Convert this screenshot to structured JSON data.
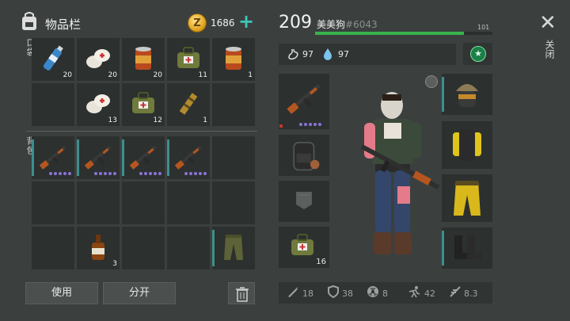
{
  "header": {
    "title": "物品栏",
    "coin_symbol": "Z",
    "coin_count": "1686",
    "add_symbol": "+"
  },
  "sections": {
    "pockets_label": "口袋",
    "backpack_label": "背包"
  },
  "pocket_slots": [
    {
      "item": "water-bottle",
      "qty": "20"
    },
    {
      "item": "bandage",
      "qty": "20"
    },
    {
      "item": "canned-food",
      "qty": "20"
    },
    {
      "item": "first-aid-bag",
      "qty": "11"
    },
    {
      "item": "canned-food",
      "qty": "1"
    },
    {
      "item": "empty",
      "qty": ""
    },
    {
      "item": "bandage",
      "qty": "13"
    },
    {
      "item": "first-aid-bag",
      "qty": "12"
    },
    {
      "item": "ammo",
      "qty": "1"
    },
    {
      "item": "empty",
      "qty": ""
    }
  ],
  "backpack_slots": [
    {
      "item": "rifle"
    },
    {
      "item": "rifle"
    },
    {
      "item": "rifle"
    },
    {
      "item": "rifle"
    },
    {
      "item": "empty"
    },
    {
      "item": "empty"
    },
    {
      "item": "empty"
    },
    {
      "item": "empty"
    },
    {
      "item": "empty"
    },
    {
      "item": "empty"
    },
    {
      "item": "empty"
    },
    {
      "item": "whiskey",
      "qty": "3"
    },
    {
      "item": "empty"
    },
    {
      "item": "empty"
    },
    {
      "item": "cargo-pants"
    }
  ],
  "actions": {
    "use_label": "使用",
    "split_label": "分开"
  },
  "player": {
    "level": "209",
    "name": "美美狗",
    "id": "#6043",
    "xp_label": "101",
    "xp_fraction": 0.84,
    "food": "97",
    "water": "97"
  },
  "equipment": {
    "weapon_label": "rifle",
    "backpack_label": "backpack",
    "pocket_label": "pocket",
    "medkit_qty": "16"
  },
  "close": {
    "symbol": "✕",
    "label": "关闭"
  },
  "bottom_stats": {
    "attack": "18",
    "defense": "38",
    "radiation": "8",
    "speed": "42",
    "stealth": "8.3"
  },
  "colors": {
    "background": "#3b403f",
    "slot": "#2c302f",
    "accent_teal": "#3fc6b7",
    "xp_green": "#39b24a",
    "quality_purple": "#8a73d6"
  }
}
